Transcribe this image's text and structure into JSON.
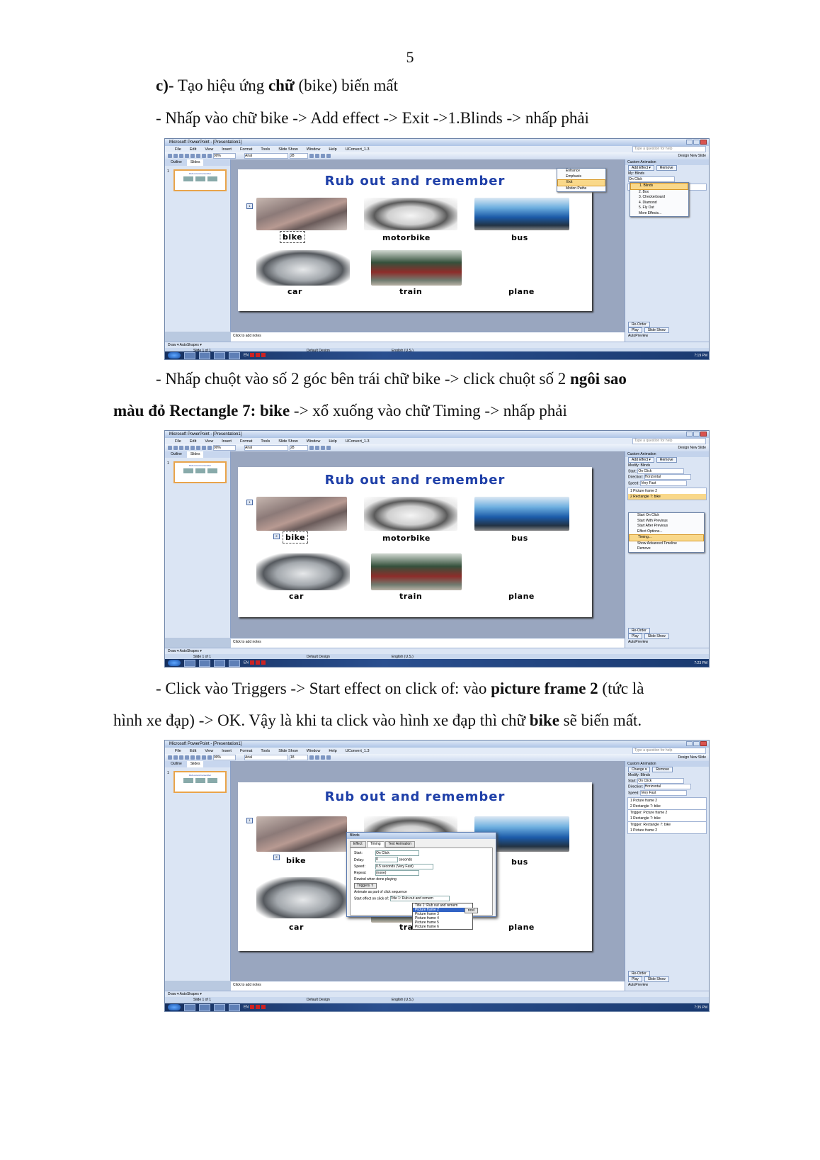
{
  "page_number": "5",
  "section_heading": {
    "prefix": "c)-",
    "text1": " Tạo hiệu ứng ",
    "bold": "chữ",
    "text2": " (bike) biến mất"
  },
  "step1": "- Nhấp vào chữ bike -> Add effect -> Exit ->1.Blinds -> nhấp phải",
  "step2": {
    "line1_text": "- Nhấp chuột vào số 2 góc bên trái chữ bike -> click chuột số 2 ",
    "line1_bold": "ngôi sao",
    "line2_bold": "màu đỏ Rectangle 7: bike",
    "line2_text": " -> xổ xuống vào chữ Timing -> nhấp phải"
  },
  "step3": {
    "line1_text": "- Click vào Triggers -> Start effect on click of: vào ",
    "line1_bold": "picture frame 2",
    "line1_end": " (tức là",
    "line2_text": "hình xe đạp) -> OK. Vậy là khi ta click vào hình xe đạp thì chữ ",
    "line2_bold": "bike",
    "line2_end": " sẽ biến mất."
  },
  "ppt": {
    "window_title": "Microsoft PowerPoint - [Presentation1]",
    "menus": [
      "File",
      "Edit",
      "View",
      "Insert",
      "Format",
      "Tools",
      "Slide Show",
      "Window",
      "Help",
      "UConvert_1.3"
    ],
    "help_box": "Type a question for help",
    "zoom": "90%",
    "font": "Arial",
    "design": "Design   New Slide",
    "tabs": [
      "Outline",
      "Slides"
    ],
    "slide_num": "1",
    "slide_title": "Rub out and remember",
    "labels": [
      "bike",
      "motorbike",
      "bus",
      "car",
      "train",
      "plane"
    ],
    "notes": "Click to add notes",
    "draw": "Draw ▾   AutoShapes ▾",
    "status_slide": "Slide 1 of 1",
    "status_design": "Default Design",
    "status_lang": "English (U.S.)",
    "taskpane_title": "Custom Animation",
    "re_order": "Re-Order",
    "play": "Play",
    "slideshow": "Slide Show",
    "autopreview": "AutoPreview"
  },
  "shot1": {
    "font_size": "28",
    "clock": "7:19 PM",
    "add_effect": "Add Effect ▾",
    "remove": "Remove",
    "effect_menu": [
      "Entrance",
      "Emphasis",
      "Exit",
      "Motion Paths"
    ],
    "exit_menu": [
      "1. Blinds",
      "2. Box",
      "3. Checkerboard",
      "4. Diamond",
      "5. Fly Out",
      "More Effects..."
    ],
    "modify": "My: Blinds",
    "start_value": "On Click",
    "list": [
      "1  Picture frame 2"
    ]
  },
  "shot2": {
    "font_size": "28",
    "clock": "7:23 PM",
    "add_effect": "Add Effect ▾",
    "remove": "Remove",
    "modify": "Modify: Blinds",
    "start_label": "Start:",
    "start_value": "On Click",
    "direction_label": "Direction:",
    "direction_value": "Horizontal",
    "speed_label": "Speed:",
    "speed_value": "Very Fast",
    "list": [
      "1  Picture frame 2",
      "2  Rectangle 7: bike"
    ],
    "context_menu": [
      "Start On Click",
      "Start With Previous",
      "Start After Previous",
      "Effect Options...",
      "Timing...",
      "Show Advanced Timeline",
      "Remove"
    ]
  },
  "shot3": {
    "font_size": "18",
    "clock": "7:35 PM",
    "change": "Change ▾",
    "remove": "Remove",
    "modify": "Modify: Blinds",
    "start_label": "Start:",
    "start_value": "On Click",
    "direction_label": "Direction:",
    "direction_value": "Horizontal",
    "speed_label": "Speed:",
    "speed_value": "Very Fast",
    "list": [
      "1  Picture frame 2",
      "2  Rectangle 7: bike"
    ],
    "trigger1": "Trigger: Picture frame 2",
    "trigger1_item": "1  Rectangle 7: bike",
    "trigger2": "Trigger: Rectangle 7: bike",
    "trigger2_item": "1  Picture frame 2",
    "dialog_title": "Blinds",
    "dialog_tabs": [
      "Effect",
      "Timing",
      "Text Animation"
    ],
    "start": "Start:",
    "start_val": "On Click",
    "delay": "Delay:",
    "delay_val": "0",
    "seconds": "seconds",
    "speed": "Speed:",
    "speed_val": "0.5 seconds (Very Fast)",
    "repeat": "Repeat:",
    "repeat_val": "(none)",
    "rewind": "Rewind when done playing",
    "triggers": "Triggers ⇑",
    "animate_seq": "Animate as part of click sequence",
    "start_on_click": "Start effect on click of:",
    "combo_val": "Title 1: Rub out and remem",
    "dropdown": [
      "Title 1: Rub out and remem",
      "Picture frame 2",
      "Picture frame 3",
      "Picture frame 4",
      "Picture frame 5",
      "Picture frame 6"
    ],
    "cancel": "ncel"
  }
}
